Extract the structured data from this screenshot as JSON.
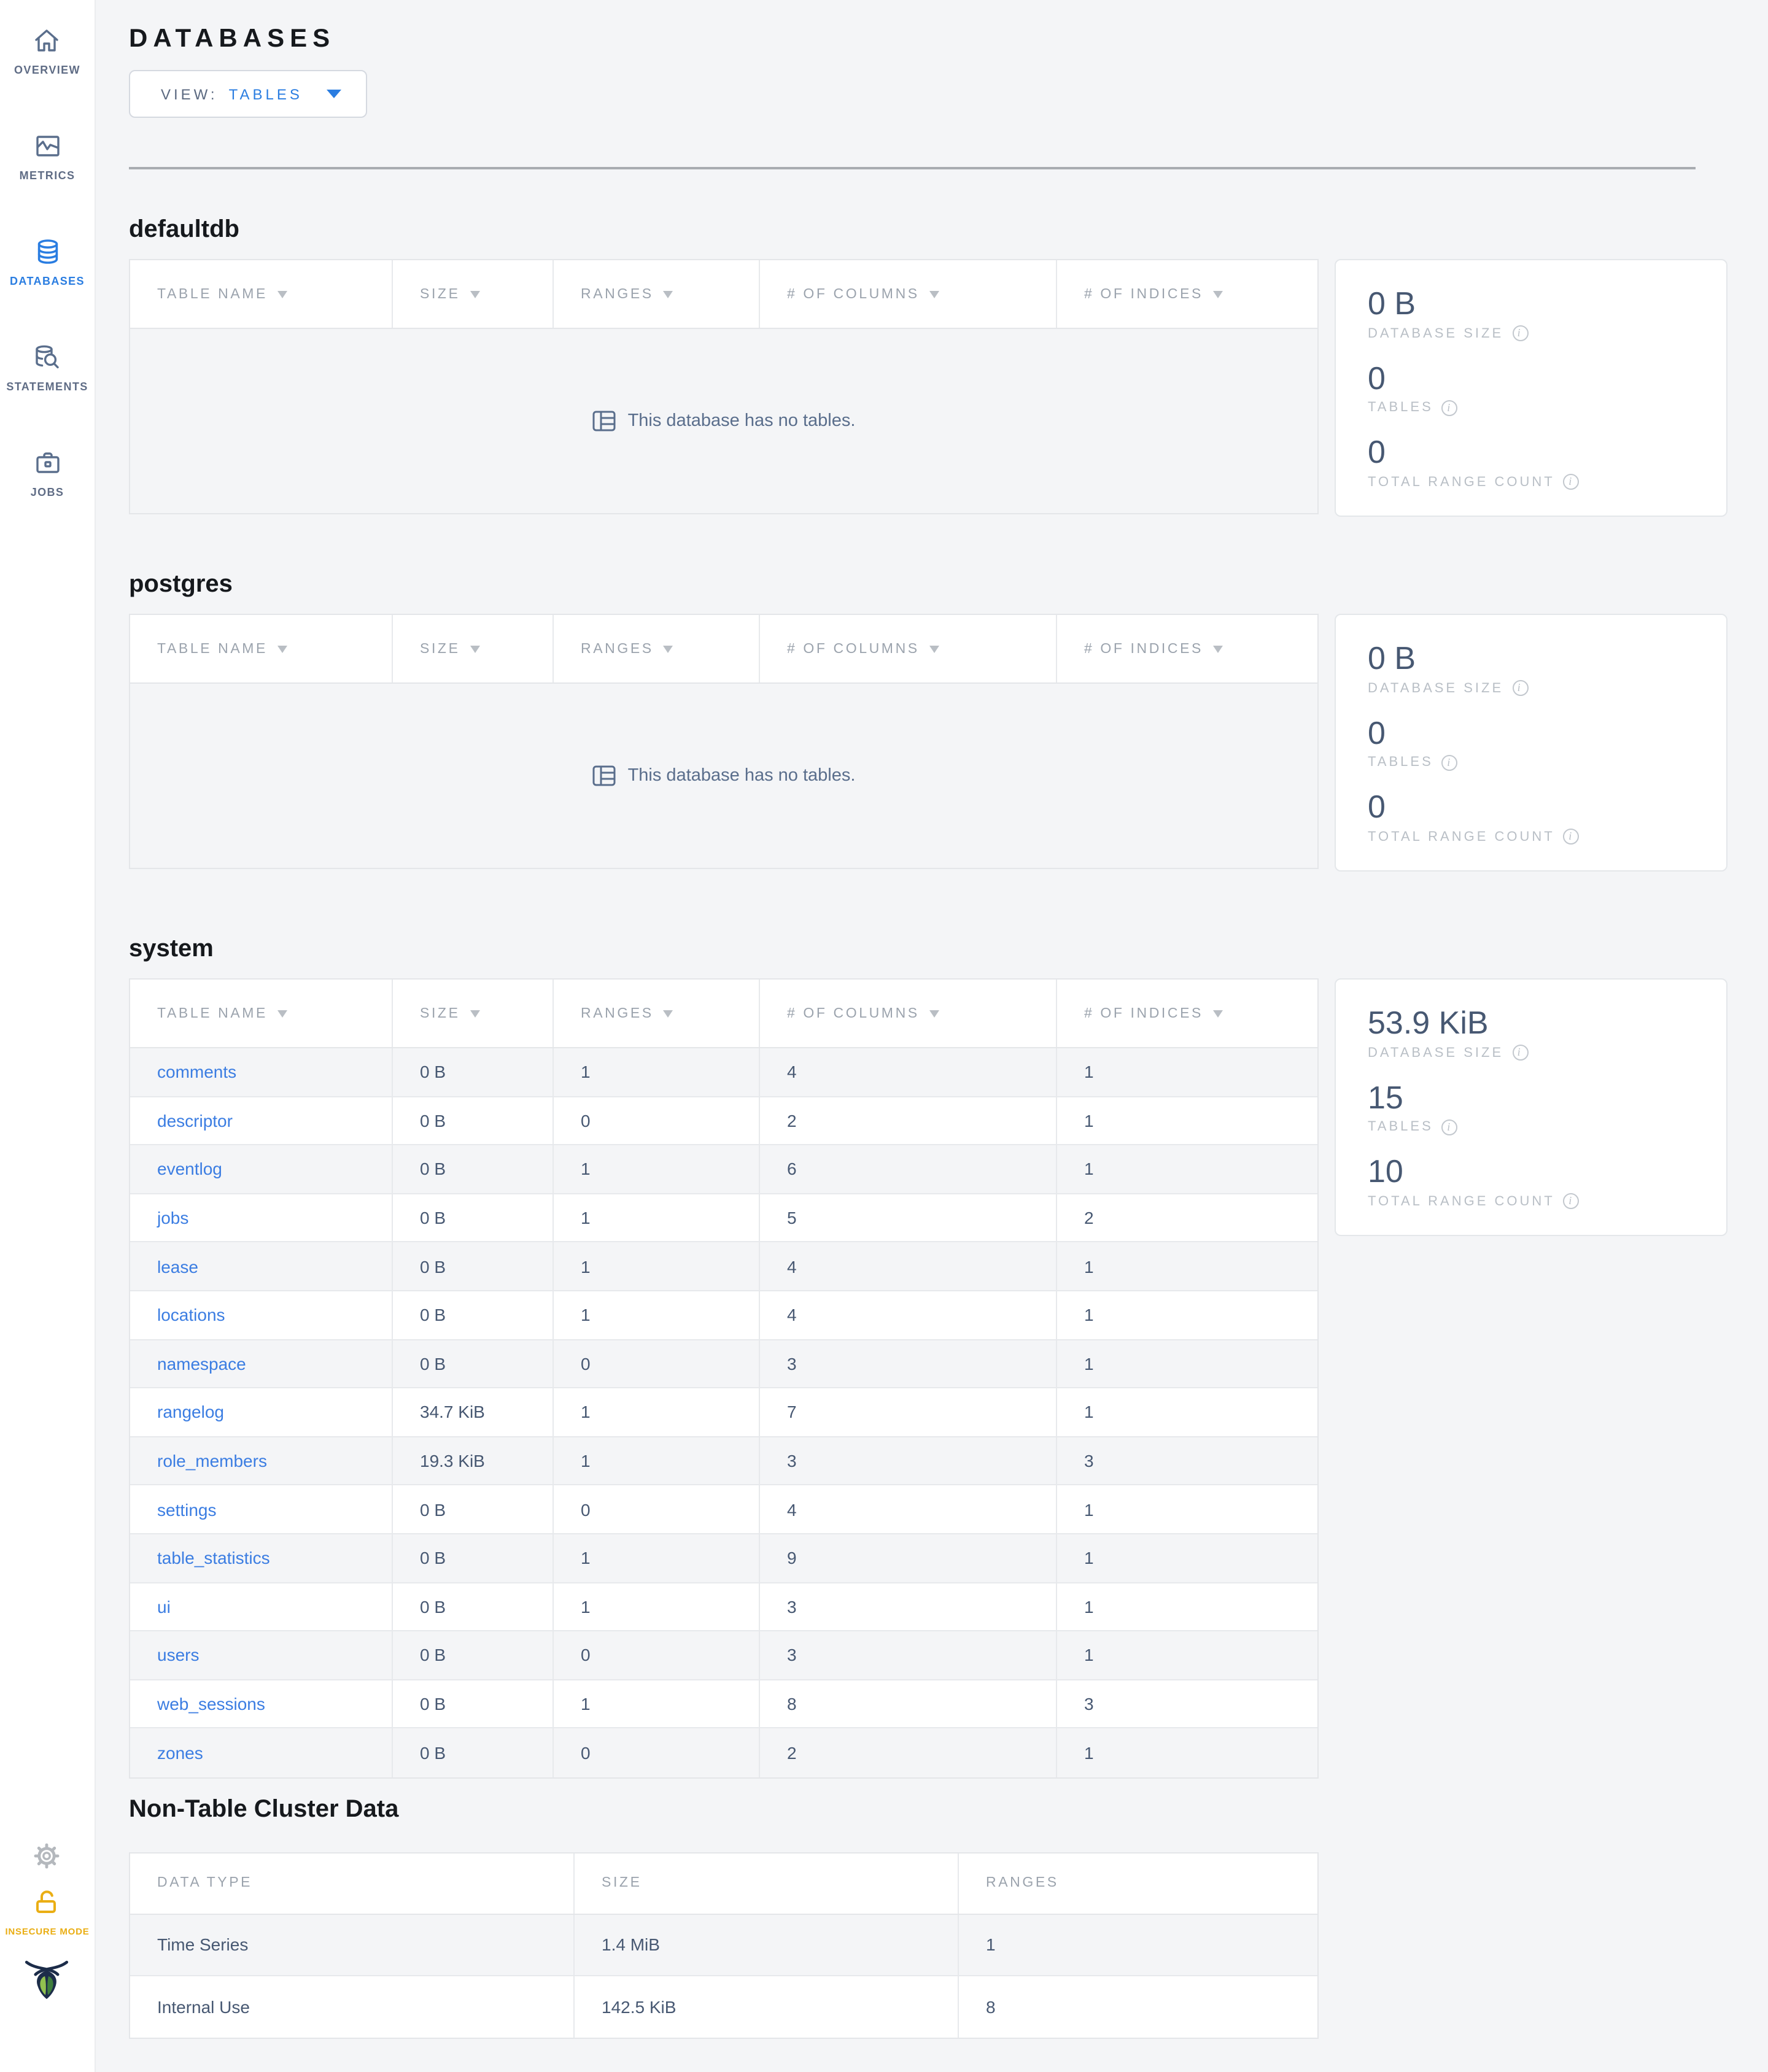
{
  "sidebar": {
    "items": [
      {
        "label": "OVERVIEW",
        "icon": "home-icon",
        "active": false
      },
      {
        "label": "METRICS",
        "icon": "metrics-icon",
        "active": false
      },
      {
        "label": "DATABASES",
        "icon": "databases-icon",
        "active": true
      },
      {
        "label": "STATEMENTS",
        "icon": "statements-icon",
        "active": false
      },
      {
        "label": "JOBS",
        "icon": "jobs-icon",
        "active": false
      }
    ],
    "footer": {
      "insecure_label": "INSECURE MODE"
    }
  },
  "header": {
    "title": "DATABASES",
    "view_label": "VIEW:",
    "view_value": "TABLES"
  },
  "table_headers": {
    "table_name": "TABLE NAME",
    "size": "SIZE",
    "ranges": "RANGES",
    "columns": "# OF COLUMNS",
    "indices": "# OF INDICES"
  },
  "empty_message": "This database has no tables.",
  "stat_labels": {
    "size": "DATABASE SIZE",
    "tables": "TABLES",
    "ranges": "TOTAL RANGE COUNT"
  },
  "databases": [
    {
      "name": "defaultdb",
      "stats": {
        "size": "0 B",
        "tables": "0",
        "range_count": "0"
      }
    },
    {
      "name": "postgres",
      "stats": {
        "size": "0 B",
        "tables": "0",
        "range_count": "0"
      }
    },
    {
      "name": "system",
      "stats": {
        "size": "53.9 KiB",
        "tables": "15",
        "range_count": "10"
      },
      "rows": [
        [
          "comments",
          "0 B",
          "1",
          "4",
          "1"
        ],
        [
          "descriptor",
          "0 B",
          "0",
          "2",
          "1"
        ],
        [
          "eventlog",
          "0 B",
          "1",
          "6",
          "1"
        ],
        [
          "jobs",
          "0 B",
          "1",
          "5",
          "2"
        ],
        [
          "lease",
          "0 B",
          "1",
          "4",
          "1"
        ],
        [
          "locations",
          "0 B",
          "1",
          "4",
          "1"
        ],
        [
          "namespace",
          "0 B",
          "0",
          "3",
          "1"
        ],
        [
          "rangelog",
          "34.7 KiB",
          "1",
          "7",
          "1"
        ],
        [
          "role_members",
          "19.3 KiB",
          "1",
          "3",
          "3"
        ],
        [
          "settings",
          "0 B",
          "0",
          "4",
          "1"
        ],
        [
          "table_statistics",
          "0 B",
          "1",
          "9",
          "1"
        ],
        [
          "ui",
          "0 B",
          "1",
          "3",
          "1"
        ],
        [
          "users",
          "0 B",
          "0",
          "3",
          "1"
        ],
        [
          "web_sessions",
          "0 B",
          "1",
          "8",
          "3"
        ],
        [
          "zones",
          "0 B",
          "0",
          "2",
          "1"
        ]
      ]
    }
  ],
  "non_table": {
    "title": "Non-Table Cluster Data",
    "headers": [
      "DATA TYPE",
      "SIZE",
      "RANGES"
    ],
    "rows": [
      [
        "Time Series",
        "1.4 MiB",
        "1"
      ],
      [
        "Internal Use",
        "142.5 KiB",
        "8"
      ]
    ]
  },
  "colors": {
    "accent_blue": "#2a7de1",
    "link_blue": "#3b7de2",
    "insecure_yellow": "#eaae14",
    "slate_text": "#475872",
    "logo_navy": "#1c2c49",
    "logo_green_light": "#91c14f",
    "logo_green_dark": "#3f7e3d"
  }
}
